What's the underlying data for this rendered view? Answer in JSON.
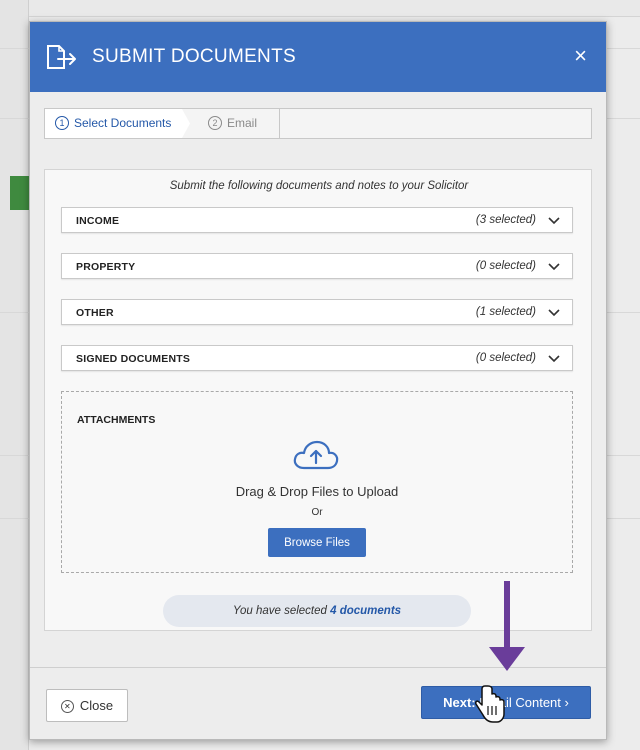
{
  "dialog": {
    "title": "SUBMIT DOCUMENTS",
    "header_color": "#3c6fbf",
    "title_icon": "document-export-icon",
    "close_icon": "close-icon",
    "close_glyph": "×"
  },
  "steps": [
    {
      "number": "1",
      "label": "Select Documents",
      "active": true
    },
    {
      "number": "2",
      "label": "Email",
      "active": false
    }
  ],
  "instruction": "Submit the following documents and notes to your Solicitor",
  "sections": [
    {
      "label": "INCOME",
      "count": "(3 selected)"
    },
    {
      "label": "PROPERTY",
      "count": "(0 selected)"
    },
    {
      "label": "OTHER",
      "count": "(1 selected)"
    },
    {
      "label": "SIGNED DOCUMENTS",
      "count": "(0 selected)"
    }
  ],
  "attachments": {
    "label": "ATTACHMENTS",
    "icon": "cloud-upload-icon",
    "drag_text": "Drag & Drop Files to Upload",
    "or_text": "Or",
    "browse_label": "Browse Files"
  },
  "summary": {
    "prefix": "You have selected",
    "count_text": "4 documents"
  },
  "footer": {
    "close_label": "Close",
    "next_bold": "Next:",
    "next_rest": "Email Content",
    "next_chevron": "›"
  },
  "annotation": {
    "arrow_color": "#6a3d9a",
    "cursor_icon": "hand-pointer-icon"
  }
}
